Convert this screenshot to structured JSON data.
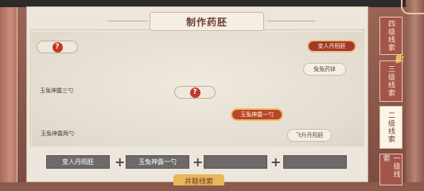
{
  "window": {
    "title": "制作药胚"
  },
  "recipe_tree": {
    "mystery_nodes": [
      {
        "label": "?"
      },
      {
        "label": "?"
      }
    ],
    "highlighted": [
      {
        "label": "变人丹阳胚"
      },
      {
        "label": "玉兔神露一勺"
      }
    ],
    "ingredients": [
      {
        "label": "兔兔药钵"
      },
      {
        "label": "玉兔神露三勺"
      },
      {
        "label": "玉兔神露两勺"
      },
      {
        "label": "飞升丹阳胚"
      }
    ]
  },
  "slots": [
    {
      "label": "变人丹阳胚"
    },
    {
      "label": "玉兔神露一勺"
    },
    {
      "label": ""
    },
    {
      "label": ""
    }
  ],
  "plus_symbol": "+",
  "craft_button": {
    "label": "并联线索"
  },
  "tabs": [
    {
      "label": "四级线索",
      "active": false
    },
    {
      "label": "三级线索",
      "active": false
    },
    {
      "label": "二级线索",
      "active": true
    },
    {
      "label": "一级线索",
      "active": false
    }
  ],
  "new_badge": "新",
  "colors": {
    "accent_red": "#a3392a",
    "panel_bg": "#ece6dc",
    "tab_inactive": "#a3554a",
    "button_gold": "#e6b85a"
  }
}
